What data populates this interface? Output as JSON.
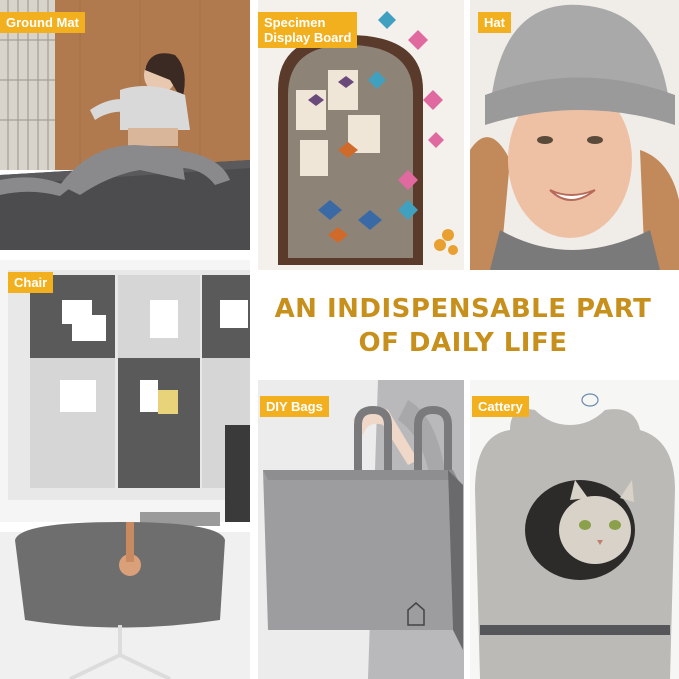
{
  "tiles": [
    {
      "id": "ground-mat",
      "label": "Ground Mat"
    },
    {
      "id": "specimen",
      "label": "Specimen\nDisplay Board"
    },
    {
      "id": "hat",
      "label": "Hat"
    },
    {
      "id": "chair",
      "label": "Chair"
    },
    {
      "id": "diy-bags",
      "label": "DIY Bags"
    },
    {
      "id": "cattery",
      "label": "Cattery"
    }
  ],
  "headline": {
    "line1": "AN INDISPENSABLE PART",
    "line2": "OF DAILY LIFE"
  }
}
